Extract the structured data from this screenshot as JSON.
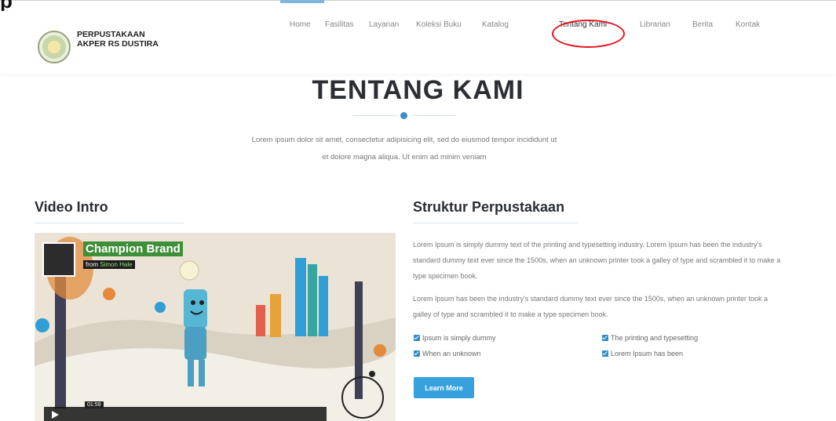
{
  "top_caption": "p",
  "header": {
    "brand_line1": "PERPUSTAKAAN",
    "brand_line2": "AKPER RS DUSTIRA",
    "nav": [
      "Home",
      "Fasilitas",
      "Layanan",
      "Koleksi Buku",
      "Katalog",
      "Tentang Kami",
      "Librarian",
      "Berita",
      "Kontak"
    ],
    "active_nav": "Tentang Kami"
  },
  "page": {
    "title": "TENTANG KAMI",
    "intro_line1": "Lorem ipsum dolor sit amet, consectetur adipisicing elit, sed do eiusmod tempor incididunt ut",
    "intro_line2": "et dolore magna aliqua. Ut enim ad minim veniam"
  },
  "video_section": {
    "heading": "Video Intro",
    "video_brand": "Champion Brand",
    "video_from": "from",
    "video_author": "Simon Hale",
    "video_time": "01:59"
  },
  "struktur": {
    "heading": "Struktur Perpustakaan",
    "para1": "Lorem Ipsum is simply dummy text of the printing and typesetting industry. Lorem Ipsum has been the industry's standard dummy text ever since the 1500s, when an unknown printer took a galley of type and scrambled it to make a type specimen book.",
    "para2": "Lorem Ipsum has been the industry's standard dummy text ever since the 1500s, when an unknown printer took a galley of type and scrambled it to make a type specimen book.",
    "checks": [
      "Ipsum is simply dummy",
      "The printing and typesetting",
      "When an unknown",
      "Lorem Ipsum has been"
    ],
    "button_label": "Learn More"
  },
  "colors": {
    "accent": "#36a1dc",
    "highlight_ring": "#e1151d",
    "heading": "#2b2f33"
  }
}
